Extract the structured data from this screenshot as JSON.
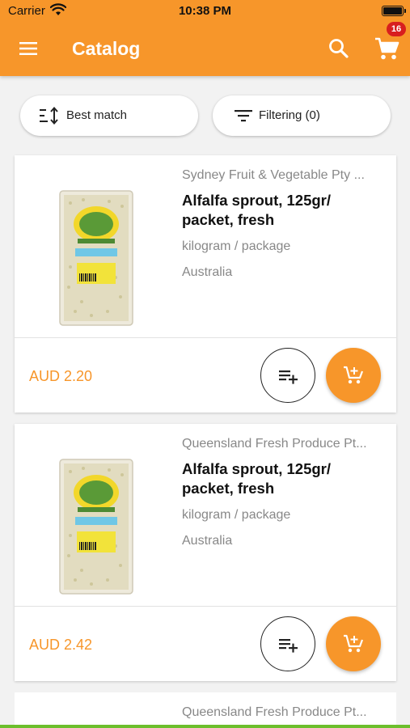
{
  "status_bar": {
    "carrier": "Carrier",
    "time": "10:38 PM"
  },
  "header": {
    "title": "Catalog",
    "cart_count": "16"
  },
  "toolbar": {
    "sort_label": "Best match",
    "filter_label": "Filtering (0)"
  },
  "products": [
    {
      "supplier": "Sydney Fruit & Vegetable Pty ...",
      "name": "Alfalfa sprout, 125gr/ packet, fresh",
      "unit": "kilogram / package",
      "origin": "Australia",
      "price": "AUD 2.20"
    },
    {
      "supplier": "Queensland Fresh Produce Pt...",
      "name": "Alfalfa sprout, 125gr/ packet, fresh",
      "unit": "kilogram / package",
      "origin": "Australia",
      "price": "AUD 2.42"
    },
    {
      "supplier": "Queensland Fresh Produce Pt..."
    }
  ],
  "colors": {
    "brand": "#f7962a",
    "badge": "#d81e1e"
  },
  "icons": [
    "menu-icon",
    "search-icon",
    "cart-icon",
    "sort-icon",
    "filter-icon",
    "playlist-add-icon",
    "add-shopping-cart-icon"
  ]
}
